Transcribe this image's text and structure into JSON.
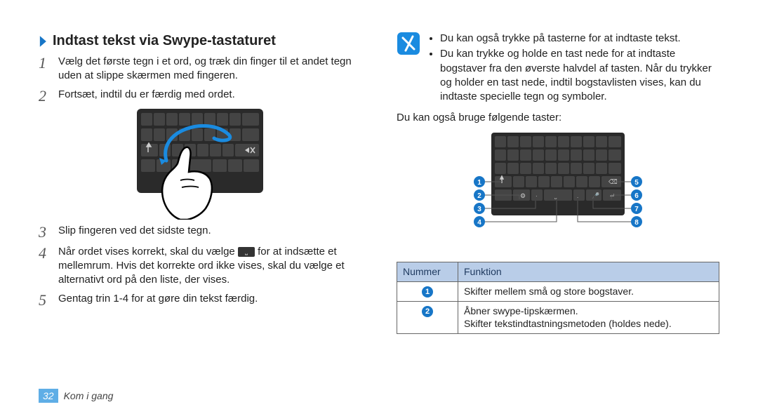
{
  "left": {
    "title": "Indtast tekst via Swype-tastaturet",
    "steps": {
      "s1": "Vælg det første tegn i et ord, og træk din finger til et andet tegn uden at slippe skærmen med fingeren.",
      "s2": "Fortsæt, indtil du er færdig med ordet.",
      "s3": "Slip fingeren ved det sidste tegn.",
      "s4a": "Når ordet vises korrekt, skal du vælge ",
      "s4b": " for at indsætte et mellemrum. Hvis det korrekte ord ikke vises, skal du vælge et alternativt ord på den liste, der vises.",
      "s5": "Gentag trin 1-4 for at gøre din tekst færdig."
    }
  },
  "right": {
    "note1": "Du kan også trykke på tasterne for at indtaste tekst.",
    "note2": "Du kan trykke og holde en tast nede for at indtaste bogstaver fra den øverste halvdel af tasten. Når du trykker og holder en tast nede, indtil bogstavlisten vises, kan du indtaste specielle tegn og symboler.",
    "para": "Du kan også bruge følgende taster:",
    "tableHead1": "Nummer",
    "tableHead2": "Funktion",
    "row1": "Skifter mellem små og store bogstaver.",
    "row2a": "Åbner swype-tipskærmen.",
    "row2b": "Skifter tekstindtastningsmetoden (holdes nede)."
  },
  "footer": {
    "pagenum": "32",
    "section": "Kom i gang"
  }
}
